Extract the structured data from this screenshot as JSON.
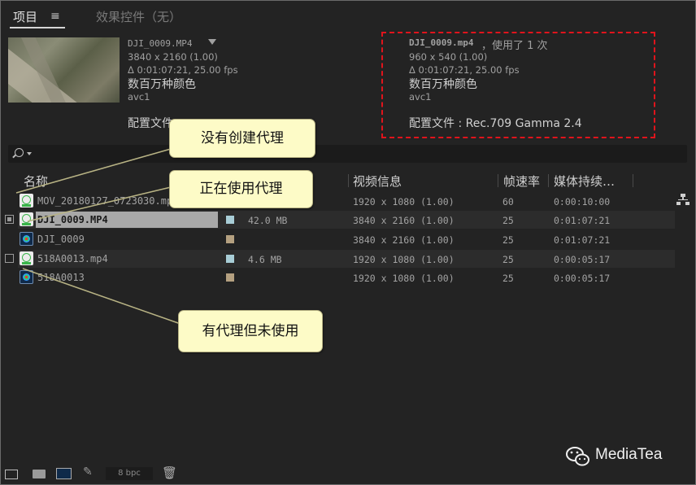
{
  "tabs": {
    "project": "项目",
    "menu": "≡",
    "effects": "效果控件（无）"
  },
  "preview_left": {
    "filename": "DJI_0009.MP4",
    "resolution": "3840 x 2160 (1.00)",
    "duration": "Δ 0:01:07:21, 25.00 fps",
    "color": "数百万种颜色",
    "codec": "avc1",
    "profile_label": "配置文件"
  },
  "preview_right": {
    "filename": "DJI_0009.mp4",
    "used": "，使用了 1 次",
    "resolution": "960 x 540 (1.00)",
    "duration": "Δ 0:01:07:21, 25.00 fps",
    "color": "数百万种颜色",
    "codec": "avc1",
    "profile": "配置文件 : Rec.709 Gamma 2.4"
  },
  "columns": {
    "name": "名称",
    "video_info": "视频信息",
    "fps": "帧速率",
    "duration": "媒体持续…"
  },
  "rows": [
    {
      "name": "MOV_20180127_0723030.mp4",
      "size": "",
      "video_info": "1920 x 1080 (1.00)",
      "fps": "60",
      "duration": "0:00:10:00",
      "label_color": ""
    },
    {
      "name": "DJI_0009.MP4",
      "size": "42.0 MB",
      "video_info": "3840 x 2160 (1.00)",
      "fps": "25",
      "duration": "0:01:07:21",
      "label_color": "#a8cdd6"
    },
    {
      "name": "DJI_0009",
      "size": "",
      "video_info": "3840 x 2160 (1.00)",
      "fps": "25",
      "duration": "0:01:07:21",
      "label_color": "#b4a080"
    },
    {
      "name": "518A0013.mp4",
      "size": "4.6 MB",
      "video_info": "1920 x 1080 (1.00)",
      "fps": "25",
      "duration": "0:00:05:17",
      "label_color": "#a8cdd6"
    },
    {
      "name": "518A0013",
      "size": "",
      "video_info": "1920 x 1080 (1.00)",
      "fps": "25",
      "duration": "0:00:05:17",
      "label_color": "#b4a080"
    }
  ],
  "bottom": {
    "bpc": "8 bpc"
  },
  "callouts": {
    "no_proxy": "没有创建代理",
    "using_proxy": "正在使用代理",
    "proxy_unused": "有代理但未使用"
  },
  "watermark": "MediaTea",
  "colors": {
    "highlight": "#e0141c",
    "callout_bg": "#fdfbc7"
  }
}
